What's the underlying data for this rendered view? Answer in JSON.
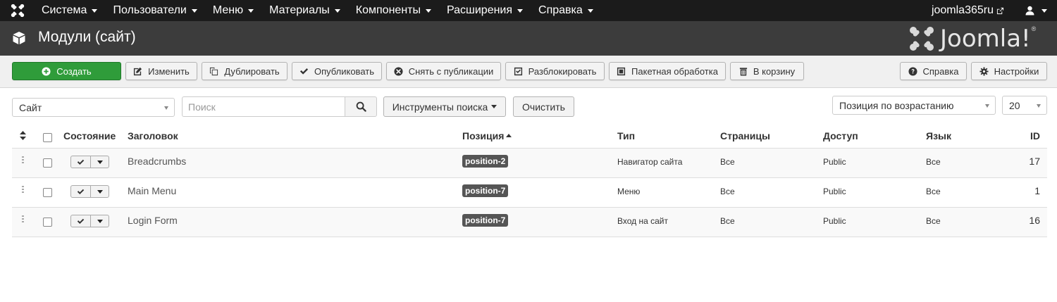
{
  "nav": {
    "menu": [
      "Система",
      "Пользователи",
      "Меню",
      "Материалы",
      "Компоненты",
      "Расширения",
      "Справка"
    ],
    "site_link": "joomla365ru"
  },
  "header": {
    "title": "Модули (сайт)",
    "brand": "Joomla!",
    "brand_reg": "®"
  },
  "toolbar": {
    "create": "Создать",
    "edit": "Изменить",
    "duplicate": "Дублировать",
    "publish": "Опубликовать",
    "unpublish": "Снять с публикации",
    "checkin": "Разблокировать",
    "batch": "Пакетная обработка",
    "trash": "В корзину",
    "help": "Справка",
    "options": "Настройки"
  },
  "filters": {
    "client": "Сайт",
    "search_placeholder": "Поиск",
    "search_tools": "Инструменты поиска",
    "clear": "Очистить",
    "ordering": "Позиция по возрастанию",
    "limit": "20"
  },
  "table": {
    "columns": {
      "state": "Состояние",
      "title": "Заголовок",
      "position": "Позиция",
      "type": "Тип",
      "pages": "Страницы",
      "access": "Доступ",
      "language": "Язык",
      "id": "ID"
    },
    "rows": [
      {
        "title": "Breadcrumbs",
        "position": "position-2",
        "type": "Навигатор сайта",
        "pages": "Все",
        "access": "Public",
        "language": "Все",
        "id": "17"
      },
      {
        "title": "Main Menu",
        "position": "position-7",
        "type": "Меню",
        "pages": "Все",
        "access": "Public",
        "language": "Все",
        "id": "1"
      },
      {
        "title": "Login Form",
        "position": "position-7",
        "type": "Вход на сайт",
        "pages": "Все",
        "access": "Public",
        "language": "Все",
        "id": "16"
      }
    ]
  },
  "colors": {
    "navbar": "#1b1b1b",
    "header": "#3c3c3c",
    "create_button": "#2f9c3a",
    "position_badge": "#555555"
  }
}
